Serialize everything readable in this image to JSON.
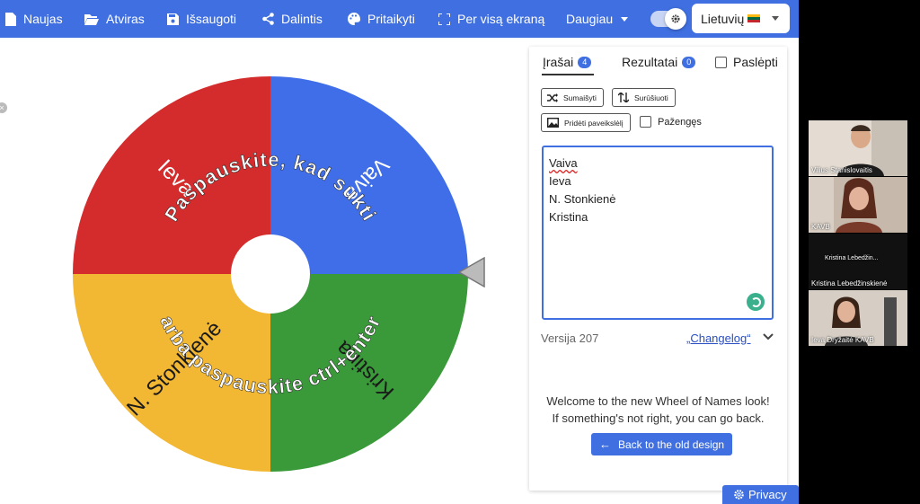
{
  "toolbar": {
    "items": [
      {
        "label": "Naujas",
        "icon": "file-icon"
      },
      {
        "label": "Atviras",
        "icon": "folder-open-icon"
      },
      {
        "label": "Išsaugoti",
        "icon": "save-icon"
      },
      {
        "label": "Dalintis",
        "icon": "share-icon"
      },
      {
        "label": "Pritaikyti",
        "icon": "palette-icon"
      },
      {
        "label": "Per visą ekraną",
        "icon": "fullscreen-icon"
      },
      {
        "label": "Daugiau",
        "icon": "caret-down-icon"
      }
    ],
    "language": "Lietuvių",
    "toggle_on": true
  },
  "wheel": {
    "slices": [
      {
        "label": "Vaiva",
        "color": "#3f6ee8"
      },
      {
        "label": "Kristina",
        "color": "#3a9a3a"
      },
      {
        "label": "N. Stonkienė",
        "color": "#f2b733"
      },
      {
        "label": "Ieva",
        "color": "#d42c2c"
      }
    ],
    "prompt_line1": "Paspauskite, kad sukti",
    "prompt_line2": "arba paspauskite ctrl+enter"
  },
  "panel": {
    "tabs": [
      {
        "label": "Įrašai",
        "count": "4"
      },
      {
        "label": "Rezultatai",
        "count": "0"
      }
    ],
    "hide_label": "Paslėpti",
    "shuffle_label": "Sumaišyti",
    "sort_label": "Surūšiuoti",
    "add_image_label": "Pridėti paveikslėlį",
    "advanced_label": "Pažengęs",
    "entries": [
      "Vaiva",
      "Ieva",
      "N. Stonkienė",
      "Kristina"
    ],
    "version": "Versija 207",
    "changelog": "„Changelog“",
    "welcome_line1": "Welcome to the new Wheel of Names look!",
    "welcome_line2": "If something's not right, you can go back.",
    "back_button": "Back to the old design"
  },
  "privacy_label": "Privacy",
  "participants": [
    {
      "name": "Vilius Stanislovaitis"
    },
    {
      "name": "KAVB"
    },
    {
      "name": "Kristina Lebedžinskienė",
      "caption": "Kristina Lebedžin..."
    },
    {
      "name": "Ieva Dryžaitė KAVB"
    }
  ]
}
